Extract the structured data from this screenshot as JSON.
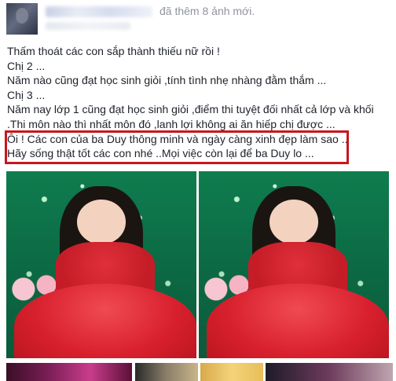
{
  "post": {
    "header": {
      "action_text": "đã thêm 8 ảnh mới."
    },
    "lines": [
      "Thấm thoát các con sắp thành thiếu nữ rồi !",
      "Chị 2 ...",
      "Năm nào cũng đạt học sinh giỏi ,tính tình nhẹ nhàng đằm thắm ...",
      "Chị 3 ...",
      "Năm nay lớp 1 cũng đạt học sinh giỏi ,điểm thi tuyệt đối nhất cả lớp và khối",
      ".Thi môn nào thì nhất môn đó ,lanh lợi không ai ăn hiếp chị được ...",
      "Ôi ! Các con của ba Duy thông minh và ngày càng xinh đẹp làm sao ..",
      "Hãy sống thật tốt các con nhé ..Mọi việc còn lại để ba Duy lo ..."
    ],
    "highlight_color": "#c8161d",
    "text_color": "#1d2129",
    "meta_color": "#90949c"
  }
}
